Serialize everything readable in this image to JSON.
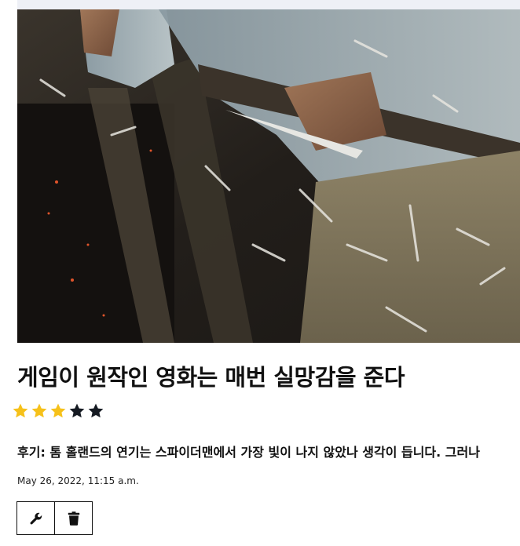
{
  "movie": {
    "poster_alt": "poster",
    "title": "게임이 원작인 영화는 매번 실망감을 준다",
    "rating": 3,
    "rating_max": 5,
    "review": "후기: 톰 홀랜드의 연기는 스파이더맨에서 가장 빛이 나지 않았나 생각이 듭니다. 그러나",
    "date": "May 26, 2022, 11:15 a.m."
  },
  "colors": {
    "star_filled": "#f6c11a",
    "star_empty": "#151a22"
  },
  "actions": {
    "edit_icon": "wrench-icon",
    "delete_icon": "trash-icon"
  }
}
